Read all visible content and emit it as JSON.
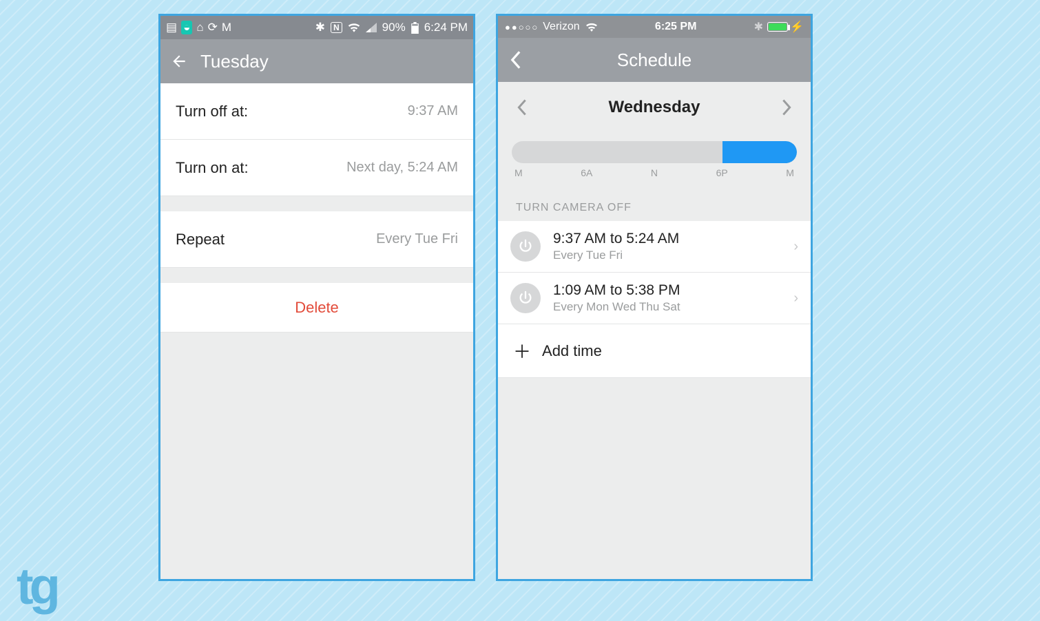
{
  "android": {
    "status": {
      "battery_pct": "90%",
      "time": "6:24 PM",
      "nfc": "N"
    },
    "header": {
      "title": "Tuesday"
    },
    "rows": {
      "turn_off_label": "Turn off at:",
      "turn_off_value": "9:37 AM",
      "turn_on_label": "Turn on at:",
      "turn_on_value": "Next day, 5:24 AM",
      "repeat_label": "Repeat",
      "repeat_value": "Every Tue Fri"
    },
    "delete_label": "Delete"
  },
  "ios": {
    "status": {
      "carrier": "Verizon",
      "time": "6:25 PM"
    },
    "nav_title": "Schedule",
    "day": "Wednesday",
    "ticks": {
      "t0": "M",
      "t1": "6A",
      "t2": "N",
      "t3": "6P",
      "t4": "M"
    },
    "section_title": "TURN CAMERA OFF",
    "items": {
      "0": {
        "range": "9:37 AM to 5:24 AM",
        "days": "Every Tue Fri"
      },
      "1": {
        "range": "1:09 AM to 5:38 PM",
        "days": "Every Mon Wed Thu Sat"
      }
    },
    "add_label": "Add time"
  },
  "logo": "tg"
}
